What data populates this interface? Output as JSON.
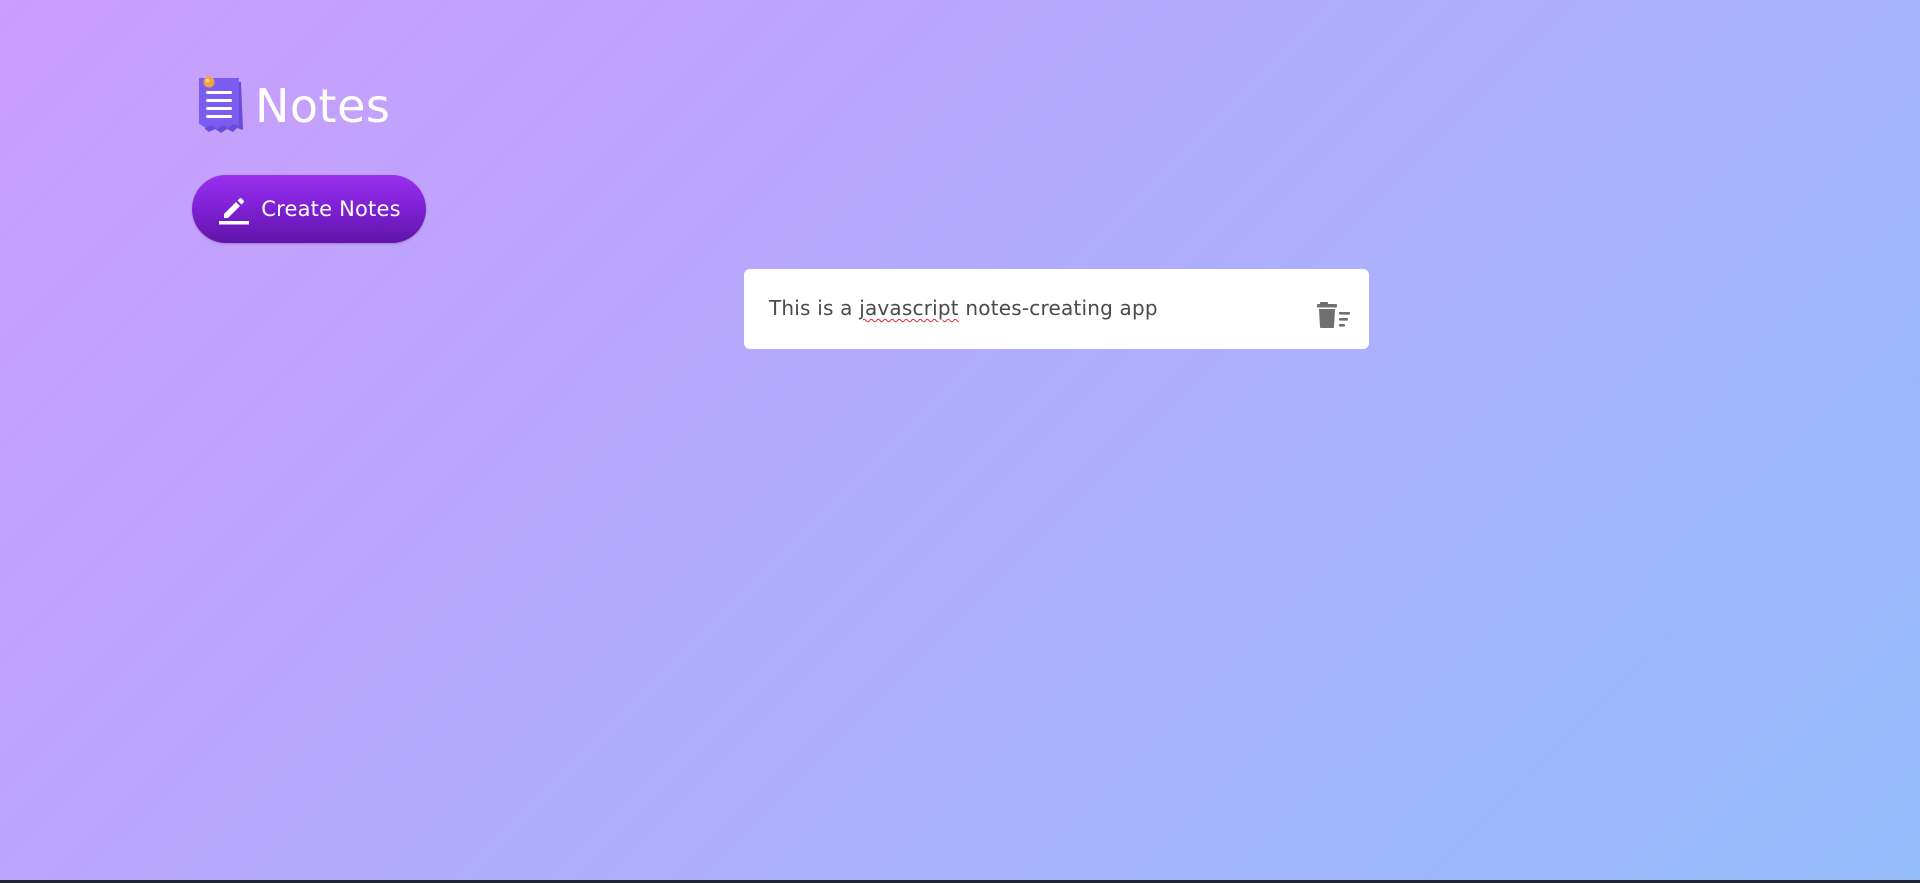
{
  "header": {
    "logo_icon": "notepad-icon",
    "title": "Notes"
  },
  "toolbar": {
    "create_icon": "pencil-icon",
    "create_label": "Create Notes"
  },
  "notes": [
    {
      "text_before": "This is a ",
      "text_flagged": "javascript",
      "text_after": " notes-creating app",
      "delete_icon": "trash-icon"
    }
  ],
  "colors": {
    "background_start": "#cb9dfd",
    "background_end": "#93bcfb",
    "button_gradient_top": "#9a2ff0",
    "button_gradient_bottom": "#5f15a6",
    "card_background": "#ffffff",
    "note_text": "#4a4a4a",
    "spellcheck_underline": "#e0243a",
    "trash_icon": "#6f6f6f"
  }
}
